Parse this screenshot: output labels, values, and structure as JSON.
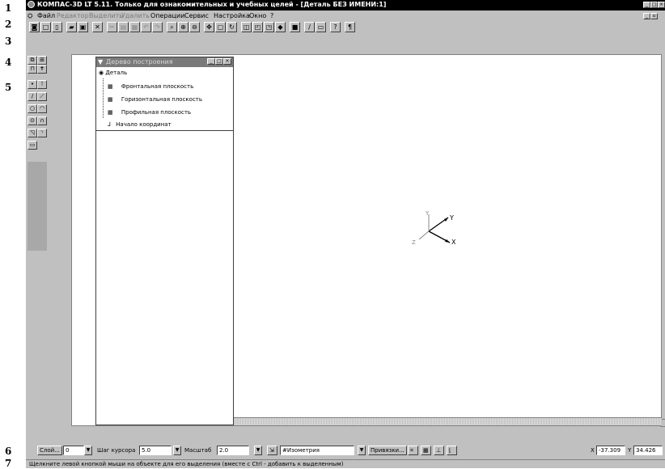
{
  "callouts": [
    "1",
    "2",
    "3",
    "4",
    "5",
    "6",
    "7"
  ],
  "window": {
    "title": "КОМПАС-3D LT 5.11. Только для ознакомительных и учебных целей - [Деталь БЕЗ ИМЕНИ:1]"
  },
  "menu": [
    {
      "label": "Файл",
      "enabled": true
    },
    {
      "label": "Редактор",
      "enabled": false
    },
    {
      "label": "Выделить",
      "enabled": false
    },
    {
      "label": "Удалить",
      "enabled": false
    },
    {
      "label": "Операции",
      "enabled": true
    },
    {
      "label": "Сервис",
      "enabled": true
    },
    {
      "label": "Настройка",
      "enabled": true
    },
    {
      "label": "Окно",
      "enabled": true
    },
    {
      "label": "?",
      "enabled": true
    }
  ],
  "tree": {
    "title": "Дерево построения",
    "root": "Деталь",
    "items": [
      "Фронтальная плоскость",
      "Горизонтальная плоскость",
      "Профильная плоскость",
      "Начало координат"
    ]
  },
  "axes": {
    "x": "X",
    "y": "Y",
    "z": "Z"
  },
  "status": {
    "layer_button": "Слой...",
    "layer_value": "0",
    "cursor_step_label": "Шаг курсора",
    "cursor_step_value": "5.0",
    "scale_label": "Масштаб",
    "scale_value": "2.0",
    "view_value": "#Изометрия",
    "snaps_button": "Привязки...",
    "x_label": "X",
    "x_value": "-37.309",
    "y_label": "Y",
    "y_value": "34.426"
  },
  "hint": "Щелкните левой кнопкой мыши на объекте для его выделения (вместе с Ctrl - добавить к выделенным)"
}
